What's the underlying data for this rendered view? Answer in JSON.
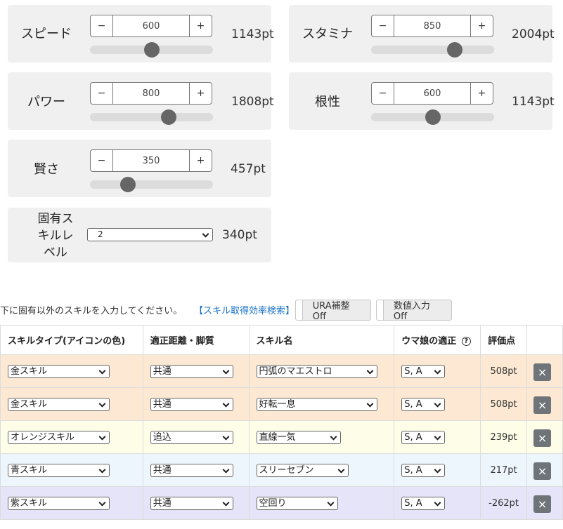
{
  "stats": {
    "speed": {
      "label": "スピード",
      "value": "600",
      "points": "1143pt",
      "slider_fraction": 0.5
    },
    "stamina": {
      "label": "スタミナ",
      "value": "850",
      "points": "2004pt",
      "slider_fraction": 0.68
    },
    "power": {
      "label": "パワー",
      "value": "800",
      "points": "1808pt",
      "slider_fraction": 0.64
    },
    "guts": {
      "label": "根性",
      "value": "600",
      "points": "1143pt",
      "slider_fraction": 0.5
    },
    "wisdom": {
      "label": "賢さ",
      "value": "350",
      "points": "457pt",
      "slider_fraction": 0.31
    }
  },
  "stepper": {
    "minus": "−",
    "plus": "+"
  },
  "unique_skill": {
    "label": "固有スキルレベル",
    "label_lines": [
      "固有ス",
      "キルレ",
      "ベル"
    ],
    "selected": "2",
    "points": "340pt"
  },
  "instructions": "下に固有以外のスキルを入力してください。",
  "search_link": "【スキル取得効率検索】",
  "toggles": {
    "ura": "URA補整Off",
    "numeric": "数値入力Off"
  },
  "table": {
    "headers": {
      "type": "スキルタイプ(アイコンの色)",
      "distance": "適正距離・脚質",
      "name": "スキル名",
      "aptitude": "ウマ娘の適正",
      "score": "評価点"
    },
    "help_icon": "?",
    "delete_icon": "×",
    "rows": [
      {
        "type": "金スキル",
        "distance": "共通",
        "name": "円弧のマエストロ",
        "aptitude": "S, A",
        "score": "508pt",
        "color": "#fde9d3"
      },
      {
        "type": "金スキル",
        "distance": "共通",
        "name": "好転一息",
        "aptitude": "S, A",
        "score": "508pt",
        "color": "#fde9d3"
      },
      {
        "type": "オレンジスキル",
        "distance": "追込",
        "name": "直線一気",
        "aptitude": "S, A",
        "score": "239pt",
        "color": "#fdfde8"
      },
      {
        "type": "青スキル",
        "distance": "共通",
        "name": "スリーセブン",
        "aptitude": "S, A",
        "score": "217pt",
        "color": "#eef6fd"
      },
      {
        "type": "紫スキル",
        "distance": "共通",
        "name": "空回り",
        "aptitude": "S, A",
        "score": "-262pt",
        "color": "#e5e4f8"
      }
    ]
  }
}
